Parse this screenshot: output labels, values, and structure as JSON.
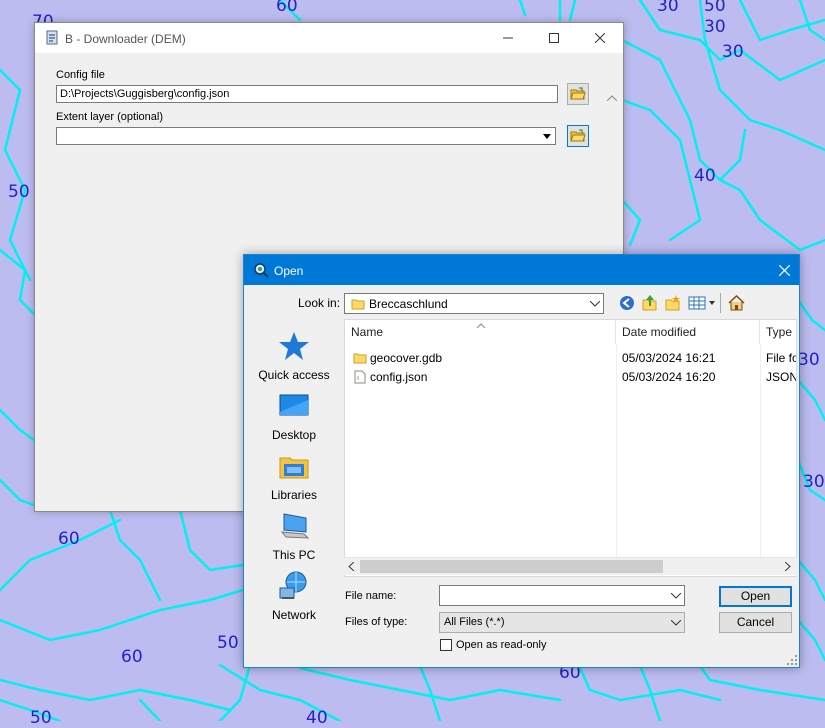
{
  "map": {
    "contour_labels": [
      "70",
      "60",
      "50",
      "30",
      "30",
      "30",
      "40",
      "50",
      "60",
      "50",
      "60",
      "60",
      "50",
      "30",
      "30",
      "40"
    ]
  },
  "plugin_window": {
    "title": "B - Downloader (DEM)",
    "config_label": "Config file",
    "config_value": "D:\\Projects\\Guggisberg\\config.json",
    "extent_label": "Extent layer (optional)",
    "extent_value": ""
  },
  "open_dialog": {
    "title": "Open",
    "look_in_label": "Look in:",
    "look_in_value": "Breccaschlund",
    "places": [
      {
        "label": "Quick access",
        "icon": "star-icon"
      },
      {
        "label": "Desktop",
        "icon": "desktop-icon"
      },
      {
        "label": "Libraries",
        "icon": "libraries-icon"
      },
      {
        "label": "This PC",
        "icon": "computer-icon"
      },
      {
        "label": "Network",
        "icon": "network-icon"
      }
    ],
    "columns": [
      "Name",
      "Date modified",
      "Type"
    ],
    "files": [
      {
        "name": "geocover.gdb",
        "date": "05/03/2024 16:21",
        "type": "File fo",
        "icon": "folder-icon"
      },
      {
        "name": "config.json",
        "date": "05/03/2024 16:20",
        "type": "JSON",
        "icon": "file-icon"
      }
    ],
    "file_name_label": "File name:",
    "file_name_value": "",
    "files_of_type_label": "Files of type:",
    "files_of_type_value": "All Files (*.*)",
    "read_only_label": "Open as read-only",
    "read_only_checked": false,
    "open_button": "Open",
    "cancel_button": "Cancel"
  }
}
